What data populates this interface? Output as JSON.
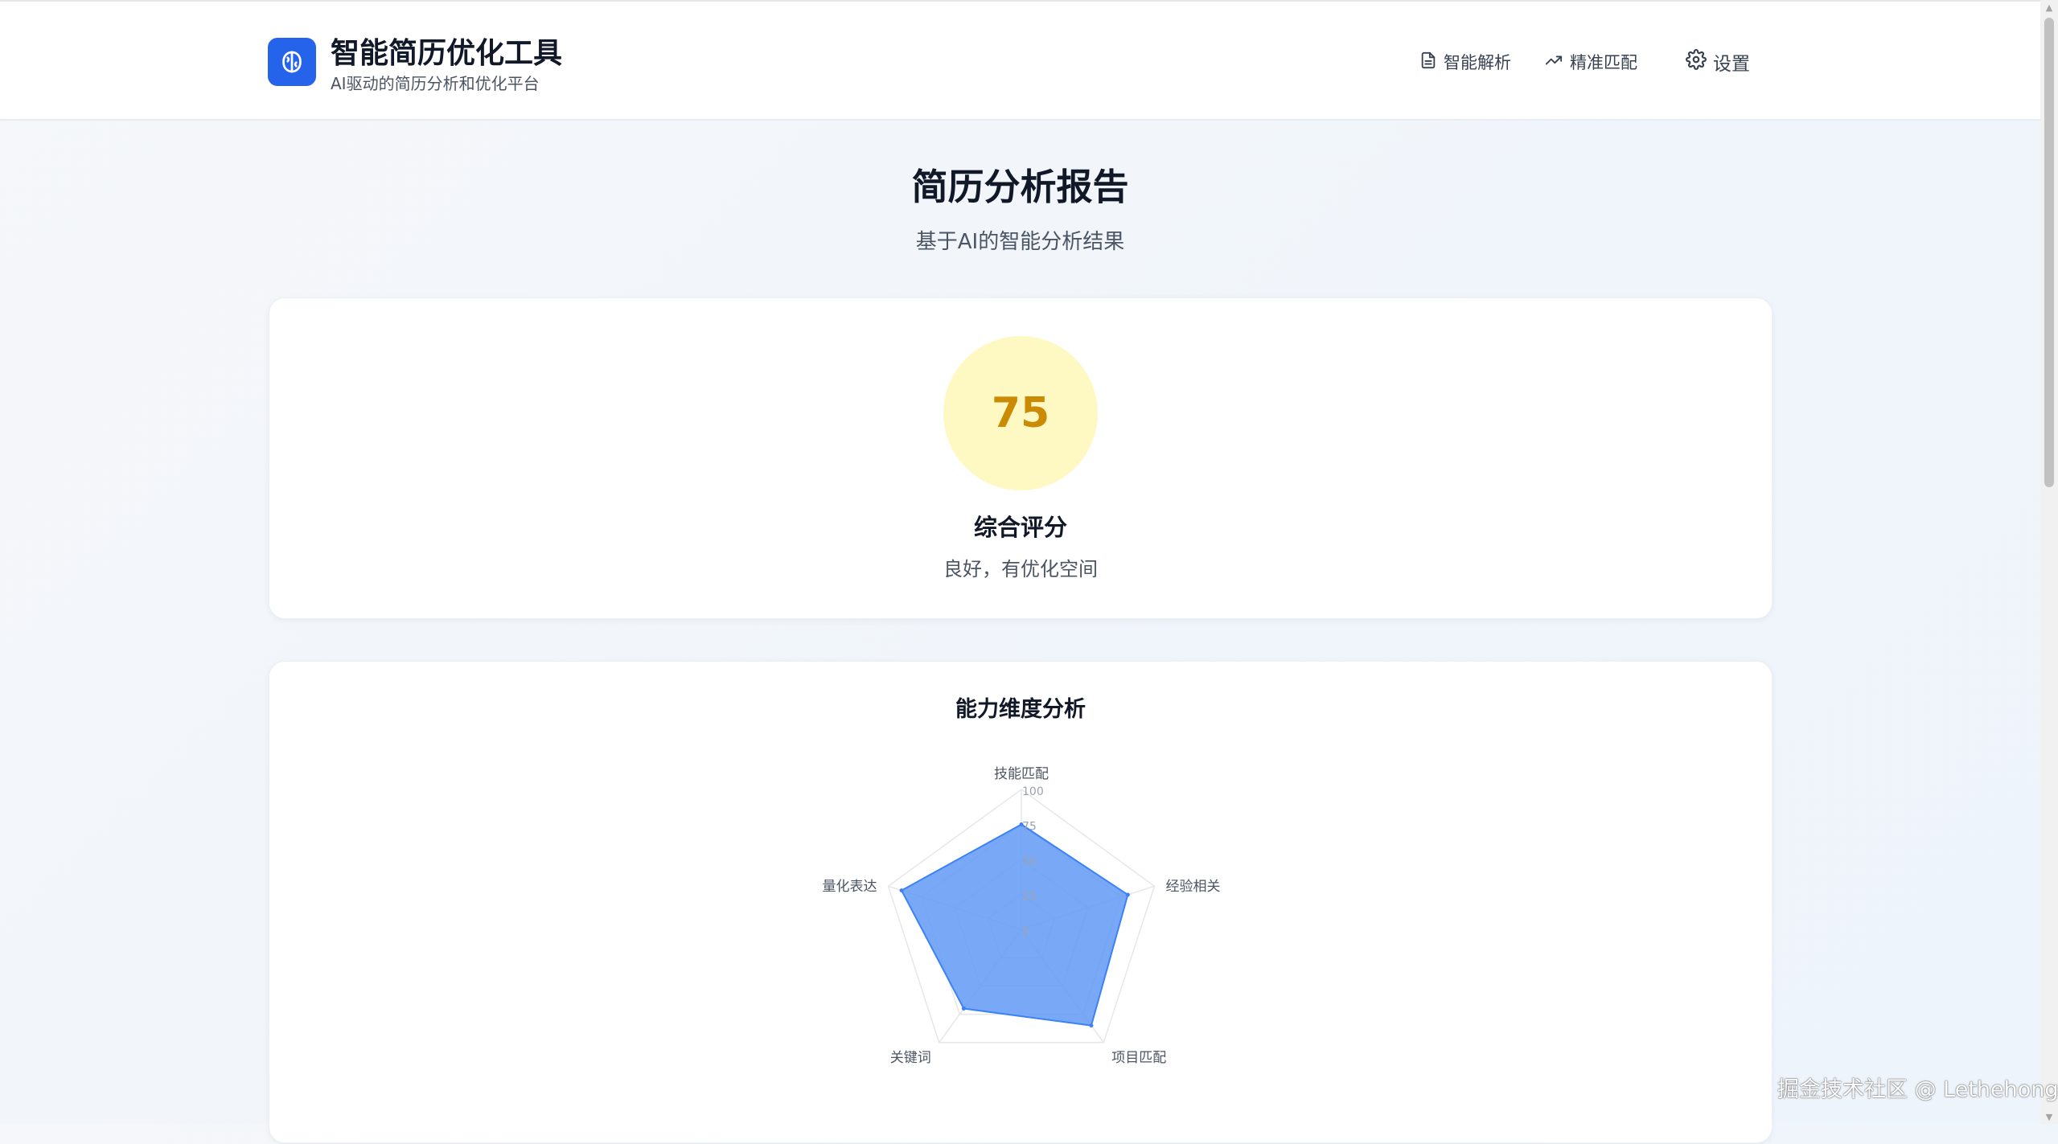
{
  "header": {
    "title": "智能简历优化工具",
    "subtitle": "AI驱动的简历分析和优化平台",
    "nav": [
      {
        "label": "智能解析",
        "icon": "document-icon"
      },
      {
        "label": "精准匹配",
        "icon": "trending-up-icon"
      },
      {
        "label": "设置",
        "icon": "gear-icon"
      }
    ]
  },
  "page": {
    "title": "简历分析报告",
    "subtitle": "基于AI的智能分析结果"
  },
  "score": {
    "value": "75",
    "label": "综合评分",
    "description": "良好，有优化空间"
  },
  "radar": {
    "title": "能力维度分析"
  },
  "chart_data": {
    "type": "radar",
    "title": "能力维度分析",
    "categories": [
      "技能匹配",
      "经验相关",
      "项目匹配",
      "关键词",
      "量化表达"
    ],
    "series": [
      {
        "values": [
          75,
          80,
          85,
          70,
          90
        ]
      }
    ],
    "rlim": [
      0,
      100
    ],
    "ticks": [
      "0",
      "25",
      "50",
      "75",
      "100"
    ],
    "colors": {
      "fill": "#6199f5",
      "stroke": "#3b82f6",
      "grid": "#e5e7eb"
    }
  },
  "colors": {
    "accent": "#2563eb",
    "score_bg": "#fef9c3",
    "score_text": "#ca8a04"
  },
  "watermark": "掘金技术社区 @ Lethehong"
}
